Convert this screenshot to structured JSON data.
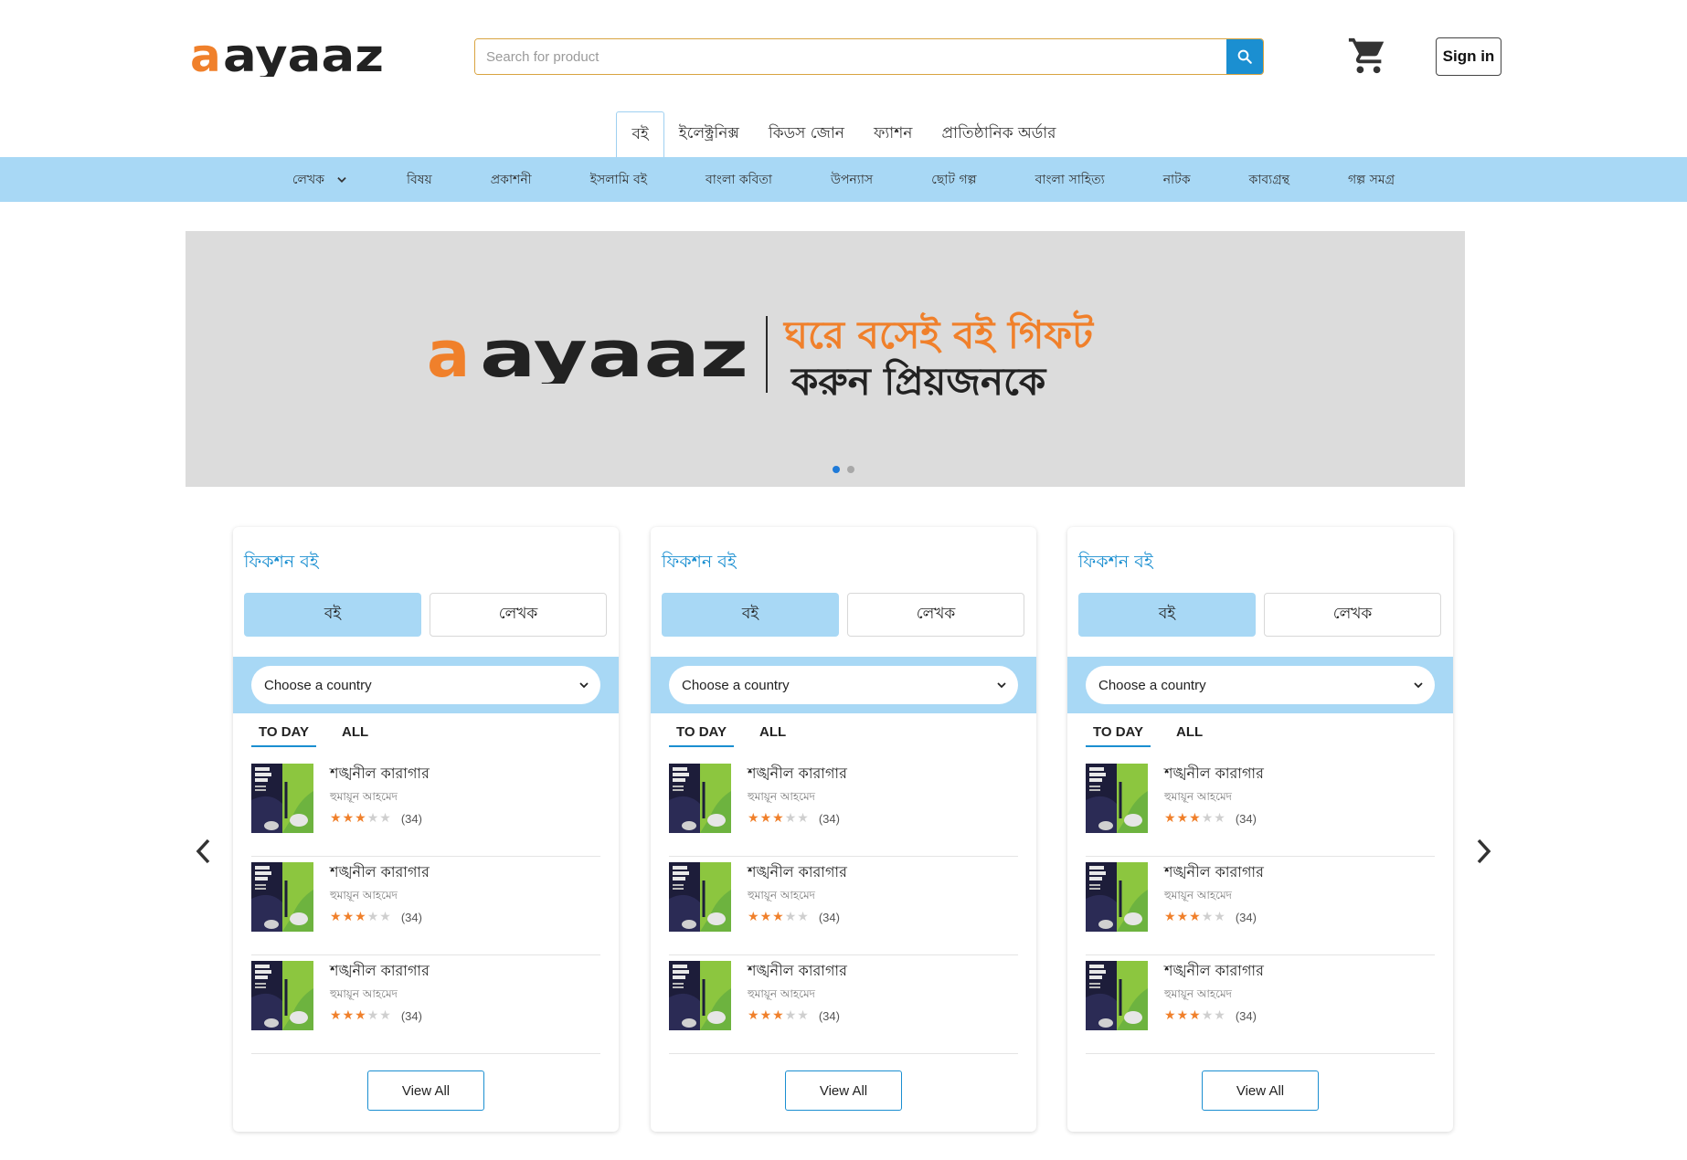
{
  "brand": {
    "logo_text": "aayaaz",
    "accent": "#f0802b",
    "primary": "#1b8fd1",
    "band": "#a8d8f5"
  },
  "header": {
    "search_placeholder": "Search for product",
    "search_icon": "search-icon",
    "cart_icon": "cart-icon",
    "signin_label": "Sign in"
  },
  "main_tabs": [
    {
      "label": "বই"
    },
    {
      "label": "ইলেক্ট্রনিক্স"
    },
    {
      "label": "কিডস জোন"
    },
    {
      "label": "ফ্যাশন"
    },
    {
      "label": "প্রাতিষ্ঠানিক অর্ডার"
    }
  ],
  "categories": [
    {
      "label": "লেখক"
    },
    {
      "label": "বিষয়"
    },
    {
      "label": "প্রকাশনী"
    },
    {
      "label": "ইসলামি বই"
    },
    {
      "label": "বাংলা কবিতা"
    },
    {
      "label": "উপন্যাস"
    },
    {
      "label": "ছোট গল্প"
    },
    {
      "label": "বাংলা সাহিত্য"
    },
    {
      "label": "নাটক"
    },
    {
      "label": "কাব্যগ্রন্থ"
    },
    {
      "label": "গল্প সমগ্র"
    }
  ],
  "banner": {
    "logo_text": "aayaaz",
    "line1": "ঘরে বসেই বই গিফট",
    "line2": "করুন প্রিয়জনকে",
    "slide_count": 2,
    "active_slide": 1
  },
  "cards": [
    {
      "title": "ফিকশন বই",
      "toggle_books": "বই",
      "toggle_authors": "লেখক",
      "select_value": "Choose a country",
      "tab_today": "TO DAY",
      "tab_all": "ALL",
      "items": [
        {
          "title": "শঙ্খনীল কারাগার",
          "author": "হুমায়ূন আহমেদ",
          "rating": 3,
          "count": "(34)"
        },
        {
          "title": "শঙ্খনীল কারাগার",
          "author": "হুমায়ূন আহমেদ",
          "rating": 3,
          "count": "(34)"
        },
        {
          "title": "শঙ্খনীল কারাগার",
          "author": "হুমায়ূন আহমেদ",
          "rating": 3,
          "count": "(34)"
        }
      ],
      "view_all": "View All"
    },
    {
      "title": "ফিকশন বই",
      "toggle_books": "বই",
      "toggle_authors": "লেখক",
      "select_value": "Choose a country",
      "tab_today": "TO DAY",
      "tab_all": "ALL",
      "items": [
        {
          "title": "শঙ্খনীল কারাগার",
          "author": "হুমায়ূন আহমেদ",
          "rating": 3,
          "count": "(34)"
        },
        {
          "title": "শঙ্খনীল কারাগার",
          "author": "হুমায়ূন আহমেদ",
          "rating": 3,
          "count": "(34)"
        },
        {
          "title": "শঙ্খনীল কারাগার",
          "author": "হুমায়ূন আহমেদ",
          "rating": 3,
          "count": "(34)"
        }
      ],
      "view_all": "View All"
    },
    {
      "title": "ফিকশন বই",
      "toggle_books": "বই",
      "toggle_authors": "লেখক",
      "select_value": "Choose a country",
      "tab_today": "TO DAY",
      "tab_all": "ALL",
      "items": [
        {
          "title": "শঙ্খনীল কারাগার",
          "author": "হুমায়ূন আহমেদ",
          "rating": 3,
          "count": "(34)"
        },
        {
          "title": "শঙ্খনীল কারাগার",
          "author": "হুমায়ূন আহমেদ",
          "rating": 3,
          "count": "(34)"
        },
        {
          "title": "শঙ্খনীল কারাগার",
          "author": "হুমায়ূন আহমেদ",
          "rating": 3,
          "count": "(34)"
        }
      ],
      "view_all": "View All"
    }
  ],
  "carousel": {
    "prev_icon": "chevron-left-icon",
    "next_icon": "chevron-right-icon"
  }
}
